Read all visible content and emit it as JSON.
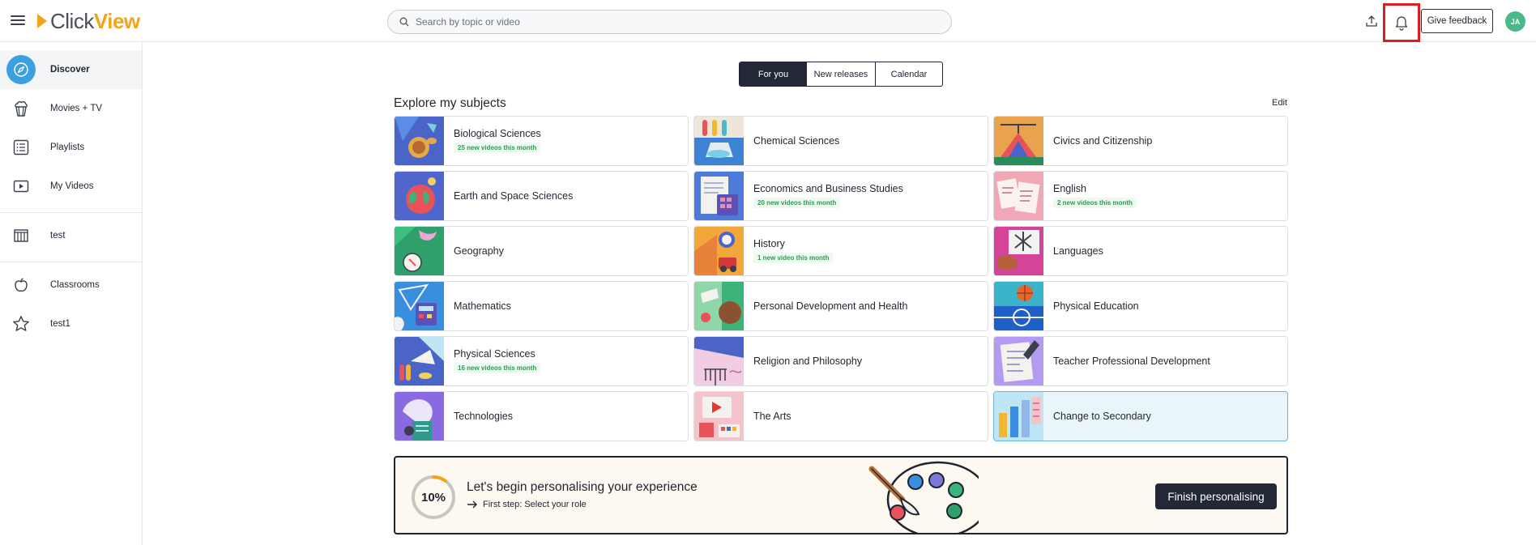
{
  "header": {
    "logo_part1": "Click",
    "logo_part2": "View",
    "search_placeholder": "Search by topic or video",
    "feedback_label": "Give feedback",
    "avatar_initials": "JA"
  },
  "sidebar": {
    "items": [
      {
        "label": "Discover",
        "icon": "compass-icon"
      },
      {
        "label": "Movies + TV",
        "icon": "popcorn-icon"
      },
      {
        "label": "Playlists",
        "icon": "list-icon"
      },
      {
        "label": "My Videos",
        "icon": "video-icon"
      },
      {
        "label": "test",
        "icon": "library-icon"
      },
      {
        "label": "Classrooms",
        "icon": "apple-icon"
      },
      {
        "label": "test1",
        "icon": "star-icon"
      }
    ]
  },
  "tabs": [
    {
      "label": "For you"
    },
    {
      "label": "New releases"
    },
    {
      "label": "Calendar"
    }
  ],
  "section": {
    "title": "Explore my subjects",
    "edit_label": "Edit"
  },
  "subjects": [
    {
      "name": "Biological Sciences",
      "badge": "25 new videos this month"
    },
    {
      "name": "Chemical Sciences",
      "badge": ""
    },
    {
      "name": "Civics and Citizenship",
      "badge": ""
    },
    {
      "name": "Earth and Space Sciences",
      "badge": ""
    },
    {
      "name": "Economics and Business Studies",
      "badge": "20 new videos this month"
    },
    {
      "name": "English",
      "badge": "2 new videos this month"
    },
    {
      "name": "Geography",
      "badge": ""
    },
    {
      "name": "History",
      "badge": "1 new video this month"
    },
    {
      "name": "Languages",
      "badge": ""
    },
    {
      "name": "Mathematics",
      "badge": ""
    },
    {
      "name": "Personal Development and Health",
      "badge": ""
    },
    {
      "name": "Physical Education",
      "badge": ""
    },
    {
      "name": "Physical Sciences",
      "badge": "16 new videos this month"
    },
    {
      "name": "Religion and Philosophy",
      "badge": ""
    },
    {
      "name": "Teacher Professional Development",
      "badge": ""
    },
    {
      "name": "Technologies",
      "badge": ""
    },
    {
      "name": "The Arts",
      "badge": ""
    },
    {
      "name": "Change to Secondary",
      "badge": ""
    }
  ],
  "banner": {
    "progress": "10%",
    "progress_value": 0.1,
    "title": "Let's begin personalising your experience",
    "step": "First step: Select your role",
    "button": "Finish personalising"
  },
  "colors": {
    "brand": "#f5a31a",
    "accent_blue": "#3b9fe0",
    "dark": "#232836",
    "highlight_border": "#e01b24",
    "badge_green": "#2e9a52"
  }
}
